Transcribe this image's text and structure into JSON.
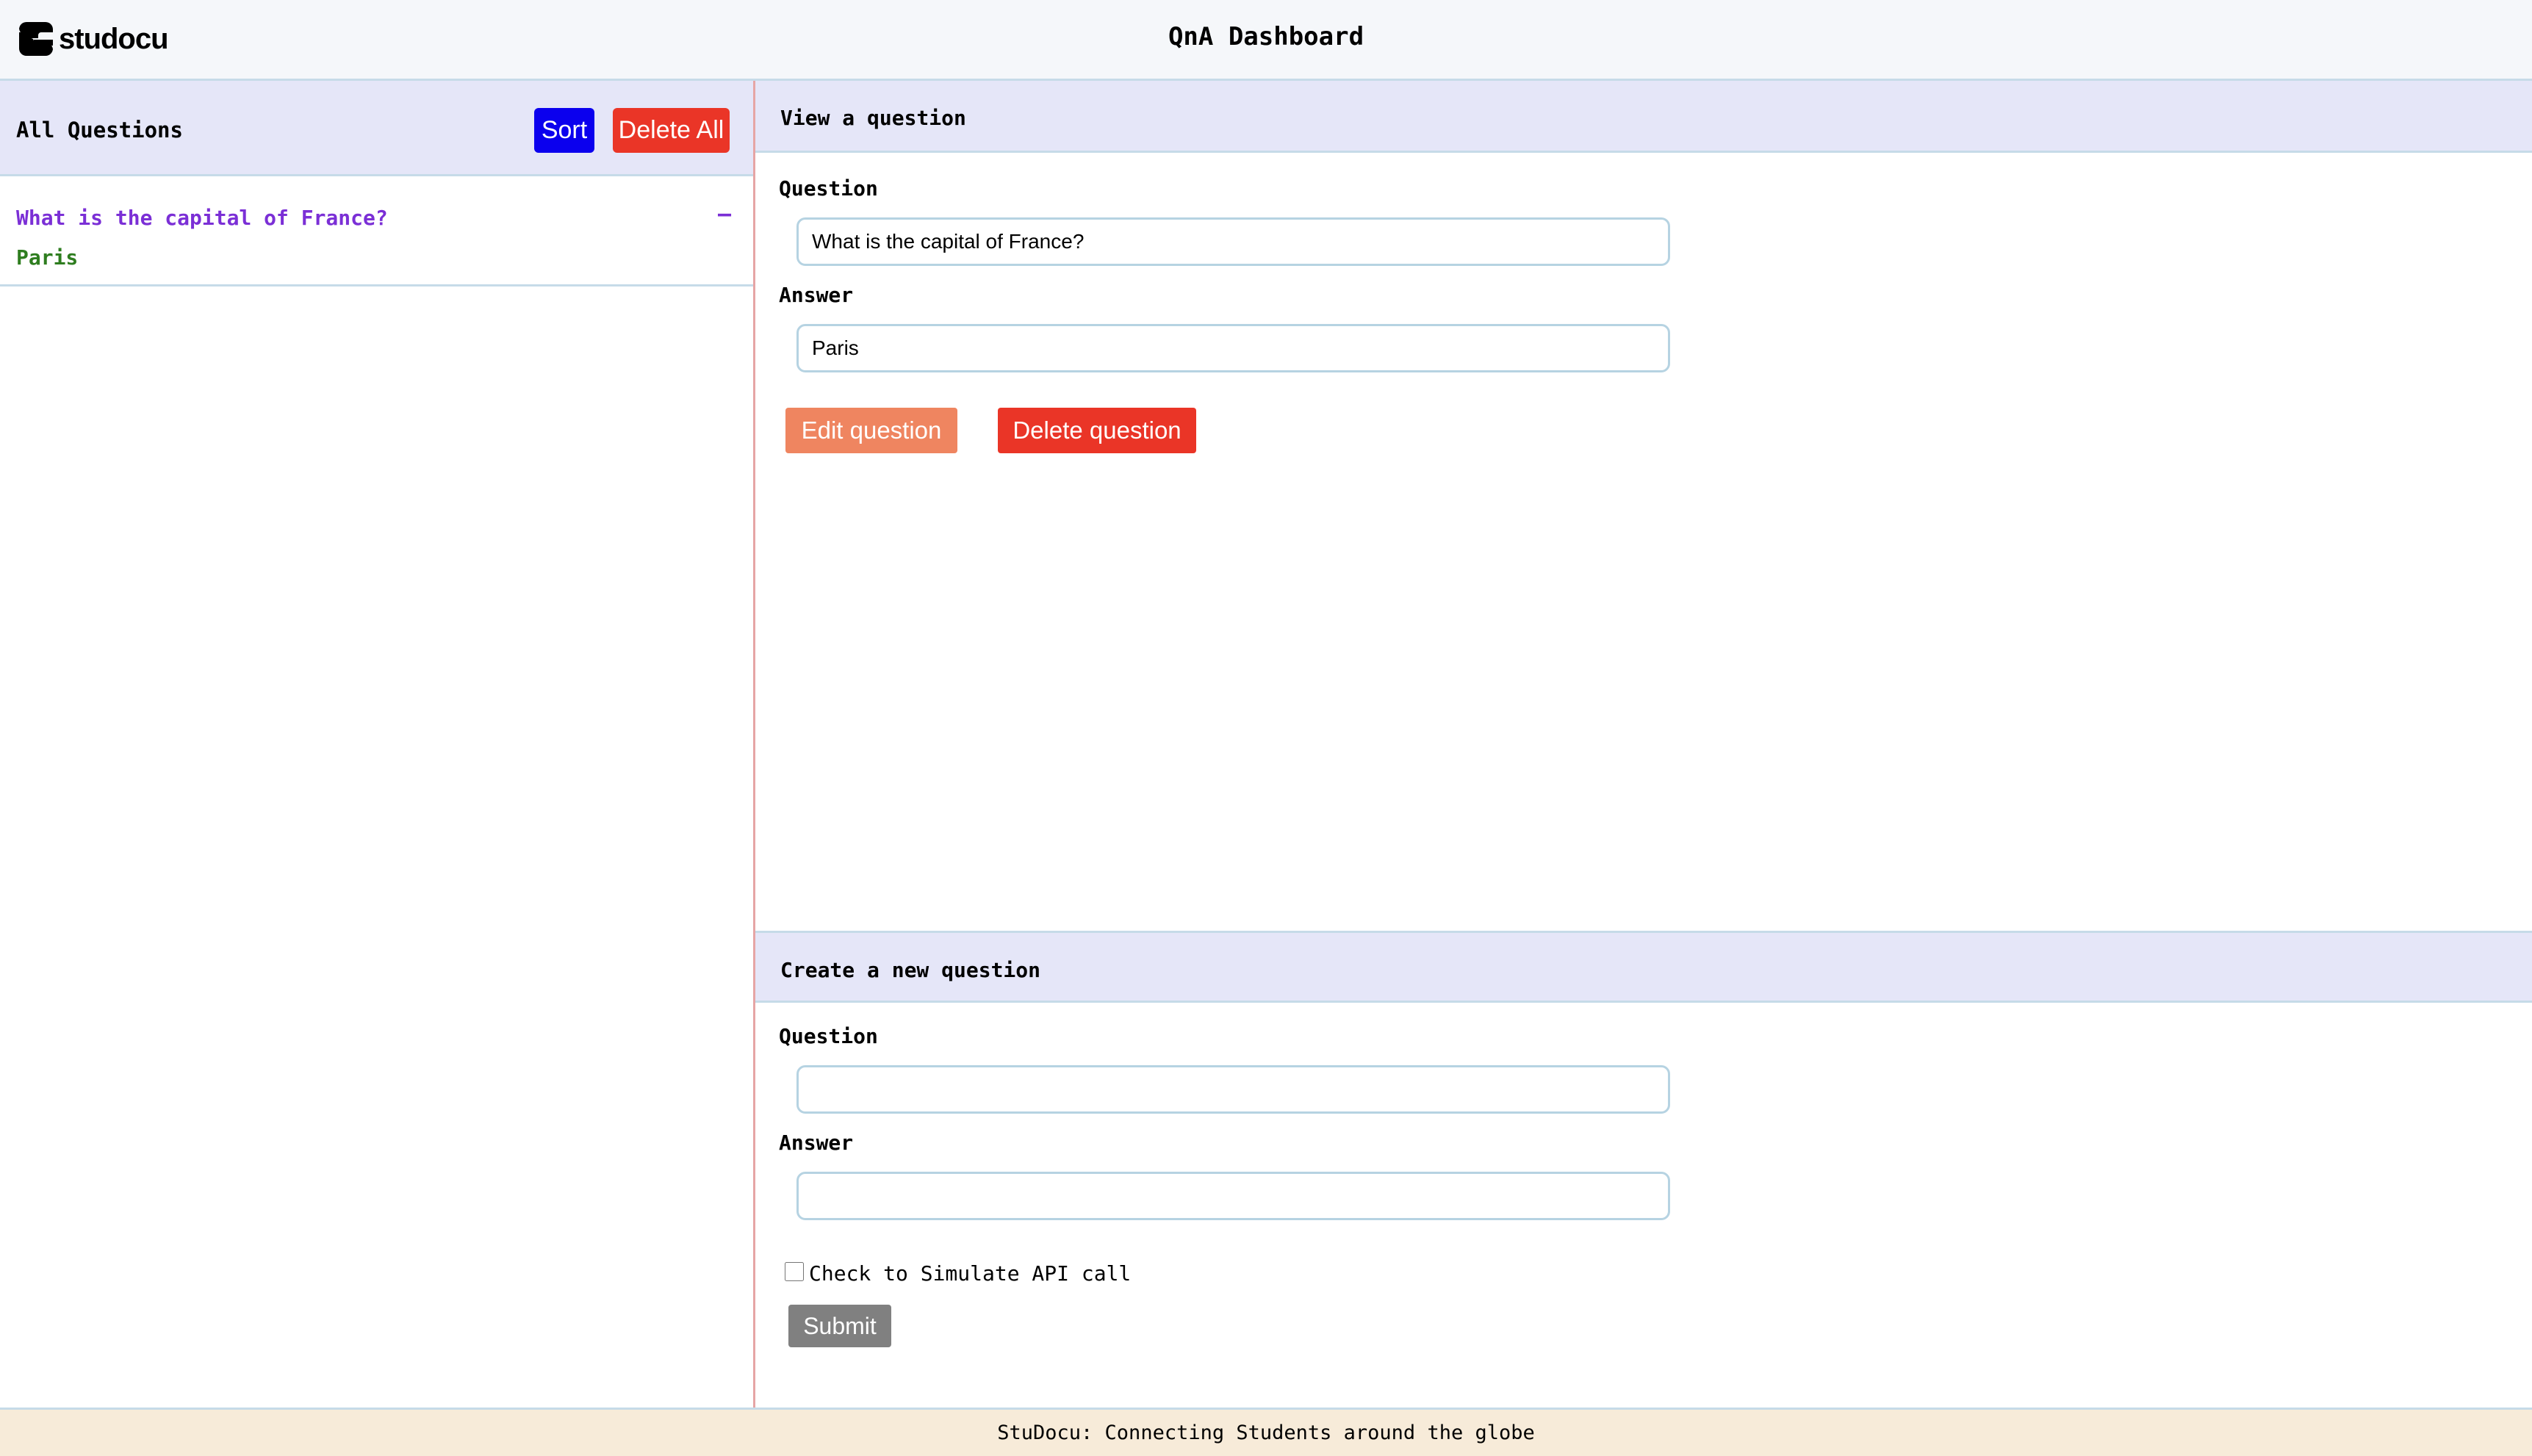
{
  "header": {
    "logo_text": "studocu",
    "title": "QnA Dashboard"
  },
  "sidebar": {
    "title": "All Questions",
    "sort_label": "Sort",
    "delete_all_label": "Delete All",
    "items": [
      {
        "question": "What is the capital of France?",
        "answer": "Paris",
        "toggle": "–"
      }
    ]
  },
  "view": {
    "title": "View a question",
    "question_label": "Question",
    "question_value": "What is the capital of France?",
    "answer_label": "Answer",
    "answer_value": "Paris",
    "edit_label": "Edit question",
    "delete_label": "Delete question"
  },
  "create": {
    "title": "Create a new question",
    "question_label": "Question",
    "question_value": "",
    "answer_label": "Answer",
    "answer_value": "",
    "checkbox_label": "Check to Simulate API call",
    "checkbox_checked": false,
    "submit_label": "Submit"
  },
  "footer": {
    "text": "StuDocu: Connecting Students around the globe"
  },
  "colors": {
    "sort_button": "#0b00ee",
    "danger_button": "#ea3527",
    "edit_button": "#ef8560",
    "submit_button": "#808080",
    "question_text": "#7b2fd6",
    "answer_text": "#2e7d1f",
    "section_header_bg": "#e5e6f8",
    "footer_bg": "#f7ebd9"
  },
  "icons": {
    "logo": "studocu-logo-icon",
    "collapse": "minus-icon"
  }
}
